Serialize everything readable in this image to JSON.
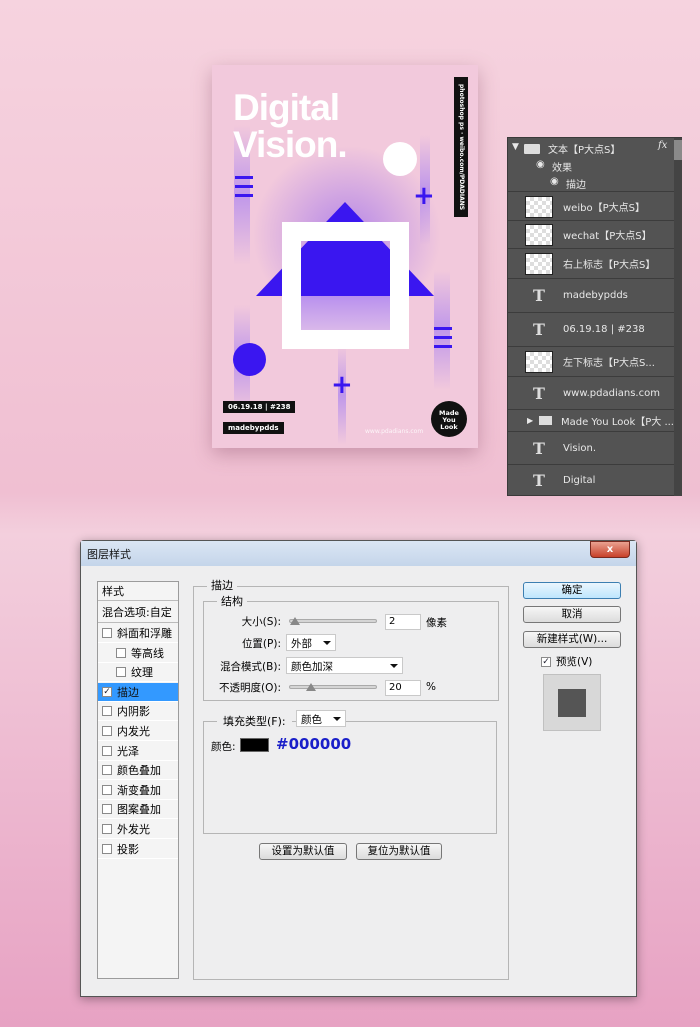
{
  "poster": {
    "title_line1": "Digital",
    "title_line2": "Vision.",
    "vertical_text": "photoshop ps  ·  weibo.com/PDADIANS",
    "date_tag": "06.19.18 | #238",
    "author_tag": "madebypdds",
    "url": "www.pdadians.com",
    "badge": "Made You Look",
    "accent": "#3a16f0"
  },
  "layers": {
    "group": {
      "name": "文本【P大点S】",
      "fx": "fx",
      "effects_label": "效果",
      "effect_item": "描边"
    },
    "rows": [
      {
        "type": "raster",
        "name": "weibo【P大点S】"
      },
      {
        "type": "raster",
        "name": "wechat【P大点S】"
      },
      {
        "type": "smart",
        "name": "右上标志【P大点S】"
      },
      {
        "type": "text",
        "name": "madebypdds"
      },
      {
        "type": "text",
        "name": "06.19.18 | #238"
      },
      {
        "type": "smart",
        "name": "左下标志【P大点S..."
      },
      {
        "type": "text",
        "name": "www.pdadians.com"
      },
      {
        "type": "group",
        "name": "Made You Look【P大 ..."
      },
      {
        "type": "text",
        "name": "Vision."
      },
      {
        "type": "text",
        "name": "Digital"
      }
    ]
  },
  "dialog": {
    "title": "图层样式",
    "close": "x",
    "styles_header": "样式",
    "blend_options": "混合选项:自定",
    "style_items": [
      {
        "label": "斜面和浮雕",
        "checked": false,
        "indent": false
      },
      {
        "label": "等高线",
        "checked": false,
        "indent": true
      },
      {
        "label": "纹理",
        "checked": false,
        "indent": true
      },
      {
        "label": "描边",
        "checked": true,
        "indent": false,
        "selected": true
      },
      {
        "label": "内阴影",
        "checked": false
      },
      {
        "label": "内发光",
        "checked": false
      },
      {
        "label": "光泽",
        "checked": false
      },
      {
        "label": "颜色叠加",
        "checked": false
      },
      {
        "label": "渐变叠加",
        "checked": false
      },
      {
        "label": "图案叠加",
        "checked": false
      },
      {
        "label": "外发光",
        "checked": false
      },
      {
        "label": "投影",
        "checked": false
      }
    ],
    "section": "描边",
    "structure": "结构",
    "size_label": "大小(S):",
    "size_value": "2",
    "size_unit": "像素",
    "position_label": "位置(P):",
    "position_value": "外部",
    "blend_label": "混合模式(B):",
    "blend_value": "颜色加深",
    "opacity_label": "不透明度(O):",
    "opacity_value": "20",
    "opacity_unit": "%",
    "fill_type_label": "填充类型(F):",
    "fill_type_value": "颜色",
    "color_label": "颜色:",
    "color_value": "#000000",
    "color_hex_text": "#000000",
    "set_default": "设置为默认值",
    "reset_default": "复位为默认值",
    "ok": "确定",
    "cancel": "取消",
    "new_style": "新建样式(W)...",
    "preview_label": "预览(V)",
    "preview_checked": true
  }
}
